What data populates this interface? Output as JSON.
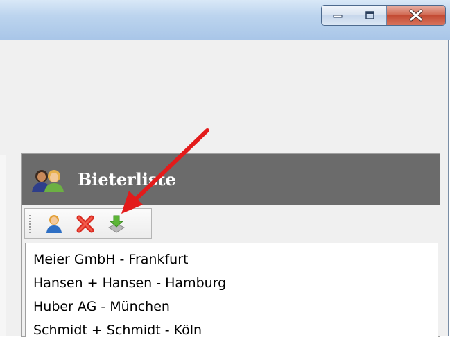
{
  "window": {
    "buttons": [
      {
        "name": "minimize",
        "icon": "minimize-icon"
      },
      {
        "name": "maximize",
        "icon": "maximize-icon"
      },
      {
        "name": "close",
        "icon": "close-icon"
      }
    ]
  },
  "panel": {
    "title": "Bieterliste",
    "header_icon": "users-icon",
    "toolbar": [
      {
        "icon": "add-user-icon"
      },
      {
        "icon": "delete-x-icon"
      },
      {
        "icon": "import-download-icon"
      }
    ],
    "items": [
      "Meier GmbH - Frankfurt",
      "Hansen + Hansen - Hamburg",
      "Huber AG - München",
      "Schmidt + Schmidt - Köln"
    ]
  },
  "annotation": {
    "type": "arrow",
    "color": "#e31b1b",
    "points_to": "import-download-icon"
  }
}
